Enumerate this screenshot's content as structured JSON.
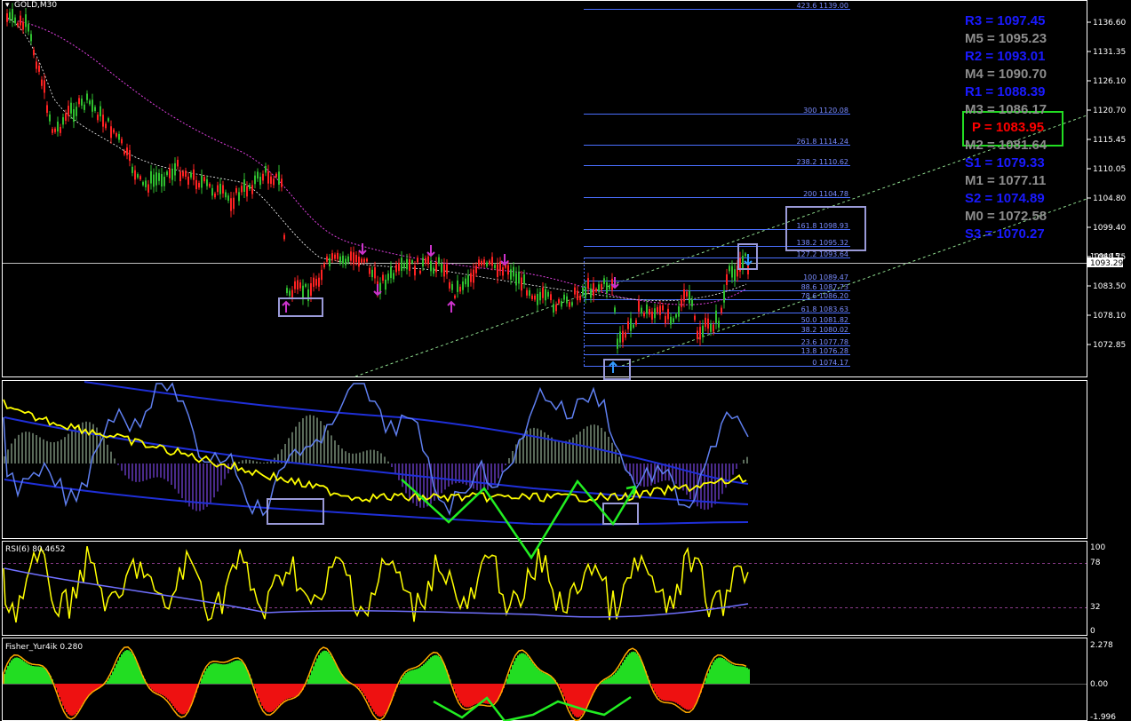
{
  "chart_title": "GOLD,M30",
  "colors": {
    "bull": "#2fbf2f",
    "bear": "#ff2222",
    "grid_line": "#ffffff",
    "fib": "#4a6fff",
    "pivot_resistance": "#1a1aff",
    "pivot_mid": "#8c8c8c",
    "pivot_main": "#ff0000",
    "highlight_box": "#9a9ad8",
    "arrow_up": "#cc33cc",
    "arrow_signal": "#3399ff",
    "rsi_yellow": "#ffff00",
    "zigzag": "#22ff22"
  },
  "price_axis": [
    "1136.60",
    "1131.35",
    "1126.10",
    "1120.70",
    "1115.45",
    "1110.05",
    "1104.80",
    "1099.40",
    "1093.29",
    "1088.75",
    "1083.50",
    "1078.10",
    "1072.85"
  ],
  "current_price": "1093.29",
  "price_marker": "1094.15",
  "fib_levels": [
    {
      "ratio": "423.6",
      "price": "1139.00"
    },
    {
      "ratio": "300",
      "price": "1120.08"
    },
    {
      "ratio": "261.8",
      "price": "1114.24"
    },
    {
      "ratio": "238.2",
      "price": "1110.62"
    },
    {
      "ratio": "200",
      "price": "1104.78"
    },
    {
      "ratio": "161.8",
      "price": "1098.93"
    },
    {
      "ratio": "138.2",
      "price": "1095.32"
    },
    {
      "ratio": "127.2",
      "price": "1093.64"
    },
    {
      "ratio": "100",
      "price": "1089.47"
    },
    {
      "ratio": "88.6",
      "price": "1087.73"
    },
    {
      "ratio": "78.6",
      "price": "1086.20"
    },
    {
      "ratio": "61.8",
      "price": "1083.63"
    },
    {
      "ratio": "50.0",
      "price": "1081.82"
    },
    {
      "ratio": "38.2",
      "price": "1080.02"
    },
    {
      "ratio": "23.6",
      "price": "1077.78"
    },
    {
      "ratio": "13.8",
      "price": "1076.28"
    },
    {
      "ratio": "0",
      "price": "1074.17"
    }
  ],
  "pivots": [
    {
      "name": "R3",
      "value": "1097.45",
      "kind": "r"
    },
    {
      "name": "M5",
      "value": "1095.23",
      "kind": "m"
    },
    {
      "name": "R2",
      "value": "1093.01",
      "kind": "r"
    },
    {
      "name": "M4",
      "value": "1090.70",
      "kind": "m"
    },
    {
      "name": "R1",
      "value": "1088.39",
      "kind": "r"
    },
    {
      "name": "M3",
      "value": "1086.17",
      "kind": "m"
    },
    {
      "name": "P",
      "value": "1083.95",
      "kind": "p"
    },
    {
      "name": "M2",
      "value": "1081.64",
      "kind": "m"
    },
    {
      "name": "S1",
      "value": "1079.33",
      "kind": "s"
    },
    {
      "name": "M1",
      "value": "1077.11",
      "kind": "m"
    },
    {
      "name": "S2",
      "value": "1074.89",
      "kind": "s"
    },
    {
      "name": "M0",
      "value": "1072.58",
      "kind": "m"
    },
    {
      "name": "S3",
      "value": "1070.27",
      "kind": "s"
    }
  ],
  "rsi": {
    "label": "RSI(6) 80.4652",
    "levels": [
      "100",
      "78",
      "32",
      "0"
    ]
  },
  "fisher": {
    "label": "Fisher_Yur4ik 0.280",
    "levels": [
      "2.278",
      "0.00",
      "-1.996"
    ]
  }
}
